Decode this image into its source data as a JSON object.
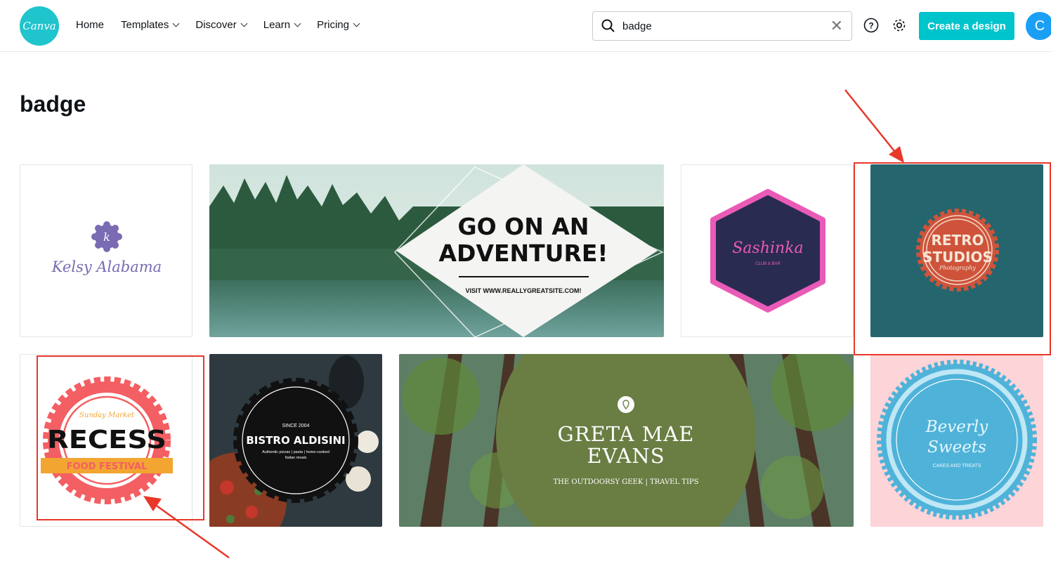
{
  "header": {
    "logo_text": "Canva",
    "nav": [
      {
        "label": "Home"
      },
      {
        "label": "Templates"
      },
      {
        "label": "Discover"
      },
      {
        "label": "Learn"
      },
      {
        "label": "Pricing"
      }
    ],
    "search_value": "badge",
    "create_label": "Create a design",
    "avatar_initial": "C"
  },
  "page": {
    "title": "badge"
  },
  "templates": {
    "kelsy": {
      "monogram": "k",
      "name": "Kelsy Alabama"
    },
    "adventure": {
      "line1": "GO ON AN",
      "line2": "ADVENTURE!",
      "url": "VISIT WWW.REALLYGREATSITE.COM!"
    },
    "sashinka": {
      "name": "Sashinka",
      "sub": "CLUB & BAR"
    },
    "retro": {
      "line1": "RETRO",
      "line2": "STUDIOS",
      "sub": "Photography"
    },
    "recess": {
      "top": "Sunday Market",
      "name": "RECESS",
      "ribbon": "FOOD FESTIVAL"
    },
    "bistro": {
      "since": "SINCE 2004",
      "name": "BISTRO ALDISINI",
      "desc1": "Authentic pizzas | pasta | home-cooked",
      "desc2": "Italian meals"
    },
    "greta": {
      "line1": "GRETA MAE",
      "line2": "EVANS",
      "sub": "THE OUTDOORSY GEEK | TRAVEL TIPS"
    },
    "beverly": {
      "line1": "Beverly",
      "line2": "Sweets",
      "sub": "CAKES AND TREATS"
    }
  },
  "colors": {
    "brand": "#00c4cc",
    "annotation": "#e8382a"
  }
}
